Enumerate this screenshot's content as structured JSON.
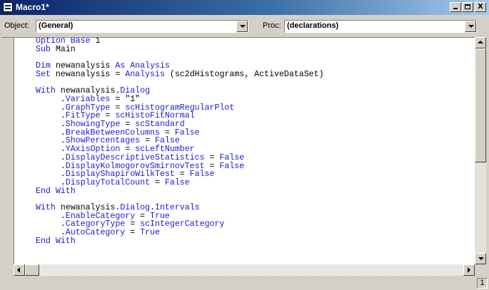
{
  "window": {
    "title": "Macro1*",
    "minimize": "_",
    "maximize": "□",
    "close": "X"
  },
  "toolbar": {
    "object_label": "Object:",
    "object_value": "(General)",
    "proc_label": "Proc:",
    "proc_value": "(declarations)"
  },
  "code": {
    "keyword_color": "#1a1ad2",
    "lines": [
      [
        {
          "t": "Option Base",
          "k": 1
        },
        {
          "t": " 1"
        }
      ],
      [
        {
          "t": "Sub",
          "k": 1
        },
        {
          "t": " Main"
        }
      ],
      [],
      [
        {
          "t": "Dim",
          "k": 1
        },
        {
          "t": " newanalysis "
        },
        {
          "t": "As Analysis",
          "k": 1
        }
      ],
      [
        {
          "t": "Set",
          "k": 1
        },
        {
          "t": " newanalysis = "
        },
        {
          "t": "Analysis",
          "k": 1
        },
        {
          "t": " (sc2dHistograms, ActiveDataSet)"
        }
      ],
      [],
      [
        {
          "t": "With",
          "k": 1
        },
        {
          "t": " newanalysis."
        },
        {
          "t": "Dialog",
          "k": 1
        }
      ],
      [
        {
          "t": "     ."
        },
        {
          "t": "Variables",
          "k": 1
        },
        {
          "t": " = \"1\""
        }
      ],
      [
        {
          "t": "     ."
        },
        {
          "t": "GraphType",
          "k": 1
        },
        {
          "t": " = "
        },
        {
          "t": "scHistogramRegularPlot",
          "k": 1
        }
      ],
      [
        {
          "t": "     ."
        },
        {
          "t": "FitType",
          "k": 1
        },
        {
          "t": " = "
        },
        {
          "t": "scHistoFitNormal",
          "k": 1
        }
      ],
      [
        {
          "t": "     ."
        },
        {
          "t": "ShowingType",
          "k": 1
        },
        {
          "t": " = "
        },
        {
          "t": "scStandard",
          "k": 1
        }
      ],
      [
        {
          "t": "     ."
        },
        {
          "t": "BreakBetweenColumns",
          "k": 1
        },
        {
          "t": " = "
        },
        {
          "t": "False",
          "k": 1
        }
      ],
      [
        {
          "t": "     ."
        },
        {
          "t": "ShowPercentages",
          "k": 1
        },
        {
          "t": " = "
        },
        {
          "t": "False",
          "k": 1
        }
      ],
      [
        {
          "t": "     ."
        },
        {
          "t": "YAxisOption",
          "k": 1
        },
        {
          "t": " = "
        },
        {
          "t": "scLeftNumber",
          "k": 1
        }
      ],
      [
        {
          "t": "     ."
        },
        {
          "t": "DisplayDescriptiveStatistics",
          "k": 1
        },
        {
          "t": " = "
        },
        {
          "t": "False",
          "k": 1
        }
      ],
      [
        {
          "t": "     ."
        },
        {
          "t": "DisplayKolmogorovSmirnovTest",
          "k": 1
        },
        {
          "t": " = "
        },
        {
          "t": "False",
          "k": 1
        }
      ],
      [
        {
          "t": "     ."
        },
        {
          "t": "DisplayShapiroWilkTest",
          "k": 1
        },
        {
          "t": " = "
        },
        {
          "t": "False",
          "k": 1
        }
      ],
      [
        {
          "t": "     ."
        },
        {
          "t": "DisplayTotalCount",
          "k": 1
        },
        {
          "t": " = "
        },
        {
          "t": "False",
          "k": 1
        }
      ],
      [
        {
          "t": "End With",
          "k": 1
        }
      ],
      [],
      [
        {
          "t": "With",
          "k": 1
        },
        {
          "t": " newanalysis."
        },
        {
          "t": "Dialog",
          "k": 1
        },
        {
          "t": "."
        },
        {
          "t": "Intervals",
          "k": 1
        }
      ],
      [
        {
          "t": "     ."
        },
        {
          "t": "EnableCategory",
          "k": 1
        },
        {
          "t": " = "
        },
        {
          "t": "True",
          "k": 1
        }
      ],
      [
        {
          "t": "     ."
        },
        {
          "t": "CategoryType",
          "k": 1
        },
        {
          "t": " = "
        },
        {
          "t": "scIntegerCategory",
          "k": 1
        }
      ],
      [
        {
          "t": "     ."
        },
        {
          "t": "AutoCategory",
          "k": 1
        },
        {
          "t": " = "
        },
        {
          "t": "True",
          "k": 1
        }
      ],
      [
        {
          "t": "End With",
          "k": 1
        }
      ]
    ]
  },
  "status": {
    "page": "1"
  }
}
